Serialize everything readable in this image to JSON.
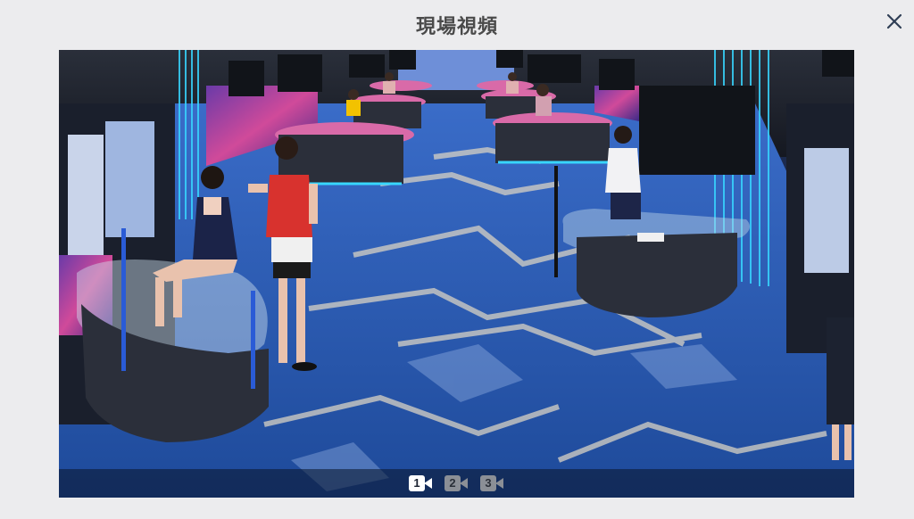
{
  "modal": {
    "title": "現場視頻",
    "close_icon": "close-icon"
  },
  "video": {
    "cameras": [
      {
        "label": "1",
        "active": true,
        "icon": "camera-icon"
      },
      {
        "label": "2",
        "active": false,
        "icon": "camera-icon"
      },
      {
        "label": "3",
        "active": false,
        "icon": "camera-icon"
      }
    ]
  },
  "colors": {
    "background": "#ececee",
    "title": "#4a4a4a",
    "carpet_blue": "#2a5bb0",
    "table_felt": "#d96aa8",
    "neon_cyan": "#38d6ff"
  }
}
